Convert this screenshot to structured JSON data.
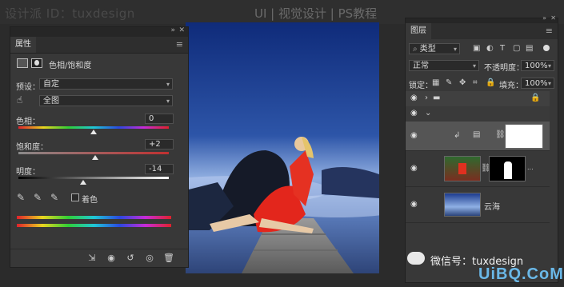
{
  "watermark": {
    "left": "设计派 ID：tuxdesign",
    "right": "UI | 视觉设计 | PS教程",
    "bottom_wechat": "微信号：tuxdesign",
    "bottom_brand": "UiBQ.CoM"
  },
  "properties_panel": {
    "tab_label": "属性",
    "adjustment_title": "色相/饱和度",
    "preset_label": "预设：",
    "preset_value": "自定",
    "channel_value": "全图",
    "hue_label": "色相：",
    "hue_value": "0",
    "hue_level": 0.5,
    "saturation_label": "饱和度：",
    "saturation_value": "+2",
    "saturation_level": 0.51,
    "lightness_label": "明度：",
    "lightness_value": "-14",
    "lightness_level": 0.43,
    "colorize_label": "着色"
  },
  "layers_panel": {
    "tab_label": "图层",
    "filter_kind": "类型",
    "blend_mode": "正常",
    "opacity_label": "不透明度：",
    "opacity_value": "100%",
    "lock_label": "锁定：",
    "fill_label": "填充：",
    "fill_value": "100%",
    "layer_bottom_name": "云海"
  },
  "icons": {
    "menu": "hamburger-icon",
    "close": "close-icon",
    "collapse": "collapse-icon",
    "eye": "eye-icon",
    "folder": "folder-icon",
    "lock": "lock-icon",
    "link": "chain-link-icon"
  },
  "colors": {
    "panel_bg": "#383838",
    "panel_dark": "#262626",
    "accent_fg": "#d6d6d6"
  }
}
